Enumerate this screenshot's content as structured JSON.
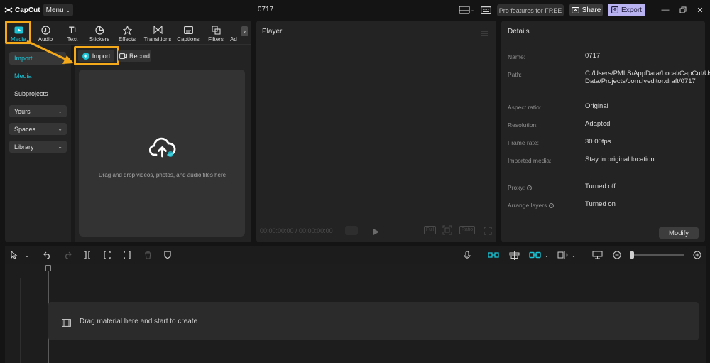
{
  "app": {
    "brand": "CapCut",
    "menu_label": "Menu",
    "project_title": "0717",
    "pro_label": "Pro features for FREE",
    "share_label": "Share",
    "export_label": "Export"
  },
  "tabs": [
    {
      "label": "Media",
      "icon": "media-icon",
      "active": true
    },
    {
      "label": "Audio",
      "icon": "audio-icon"
    },
    {
      "label": "Text",
      "icon": "text-icon"
    },
    {
      "label": "Stickers",
      "icon": "sticker-icon"
    },
    {
      "label": "Effects",
      "icon": "effects-icon"
    },
    {
      "label": "Transitions",
      "icon": "transitions-icon"
    },
    {
      "label": "Captions",
      "icon": "captions-icon"
    },
    {
      "label": "Filters",
      "icon": "filters-icon"
    },
    {
      "label": "Ad",
      "icon": "adjust-icon"
    }
  ],
  "sidebar": {
    "import": "Import",
    "media": "Media",
    "subprojects": "Subprojects",
    "yours": "Yours",
    "spaces": "Spaces",
    "library": "Library"
  },
  "media": {
    "import_label": "Import",
    "record_label": "Record",
    "drop_text": "Drag and drop videos, photos, and audio files here"
  },
  "player": {
    "title": "Player",
    "timecode": "00:00:00:00 / 00:00:00:00",
    "full_label": "Full",
    "ratio_label": "Ratio"
  },
  "details": {
    "title": "Details",
    "rows": [
      {
        "label": "Name:",
        "value": "0717"
      },
      {
        "label": "Path:",
        "value": "C:/Users/PMLS/AppData/Local/CapCut/User Data/Projects/com.lveditor.draft/0717"
      },
      {
        "label": "Aspect ratio:",
        "value": "Original"
      },
      {
        "label": "Resolution:",
        "value": "Adapted"
      },
      {
        "label": "Frame rate:",
        "value": "30.00fps"
      },
      {
        "label": "Imported media:",
        "value": "Stay in original location"
      },
      {
        "label": "Proxy:",
        "value": "Turned off"
      },
      {
        "label": "Arrange layers",
        "value": "Turned on"
      }
    ],
    "modify_label": "Modify"
  },
  "timeline": {
    "drag_text": "Drag material here and start to create"
  },
  "colors": {
    "accent_cyan": "#19c2d4",
    "highlight_orange": "#f4a91a",
    "export_bg": "#b9b3f2"
  }
}
